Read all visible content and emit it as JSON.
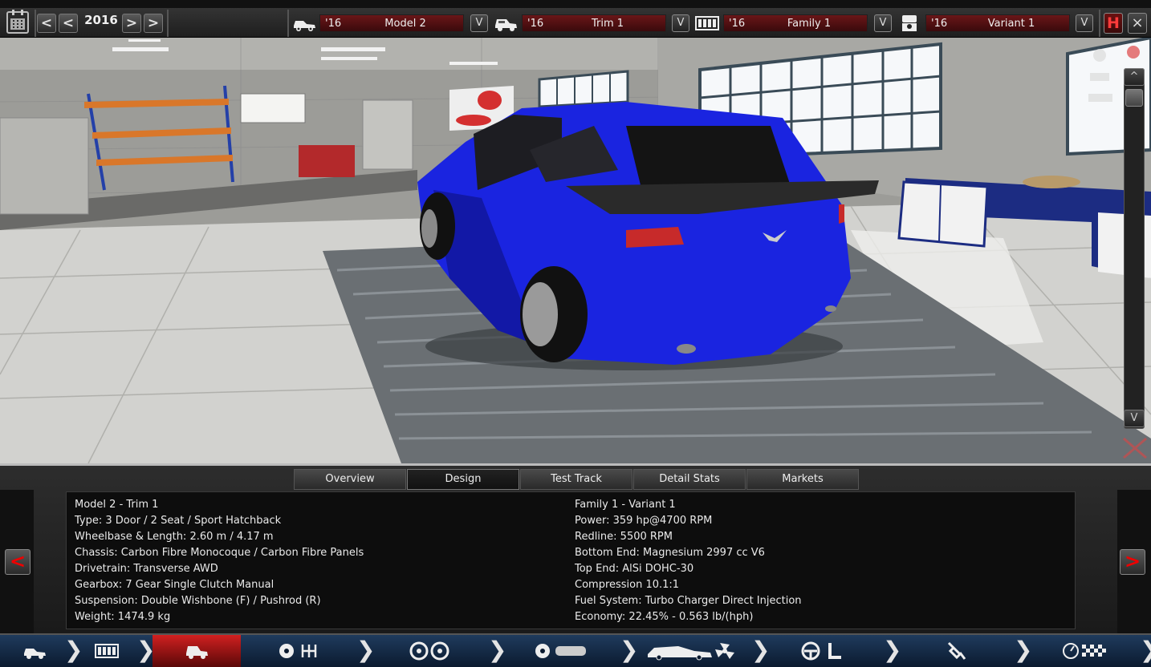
{
  "topbar": {
    "year": "2016",
    "prev_label": "<",
    "next_label": ">",
    "selectors": [
      {
        "year": "'16",
        "name": "Model 2",
        "icon": "car-model-icon"
      },
      {
        "year": "'16",
        "name": "Trim 1",
        "icon": "car-trim-icon"
      },
      {
        "year": "'16",
        "name": "Family 1",
        "icon": "engine-block-icon"
      },
      {
        "year": "'16",
        "name": "Variant 1",
        "icon": "piston-icon"
      }
    ],
    "dropdown_label": "V",
    "save_label": "H",
    "close_label": "×"
  },
  "viewport": {
    "scroll_up_label": "^",
    "scroll_down_label": "V",
    "car_color": "#1a24e0"
  },
  "tabs": [
    "Overview",
    "Design",
    "Test Track",
    "Detail Stats",
    "Markets"
  ],
  "active_tab": "Design",
  "panel": {
    "prev_label": "<",
    "next_label": ">"
  },
  "stats": {
    "left": [
      "Model 2 - Trim 1",
      "Type: 3 Door / 2 Seat / Sport Hatchback",
      "Wheelbase & Length: 2.60 m / 4.17 m",
      "Chassis: Carbon Fibre Monocoque / Carbon Fibre Panels",
      "Drivetrain: Transverse AWD",
      "Gearbox: 7 Gear Single Clutch Manual",
      "Suspension: Double Wishbone (F) / Pushrod (R)",
      "Weight: 1474.9 kg"
    ],
    "right": [
      "Family 1 - Variant 1",
      "Power: 359 hp@4700 RPM",
      "Redline: 5500 RPM",
      "Bottom End: Magnesium 2997 cc V6",
      "Top End: AlSi DOHC-30",
      "Compression 10.1:1",
      "Fuel System: Turbo Charger Direct Injection",
      "Economy: 22.45% - 0.563 lb/(hph)"
    ]
  },
  "bottombar": {
    "steps": [
      "car-model-step-icon",
      "engine-family-step-icon",
      "car-trim-step-icon",
      "gearbox-step-icon",
      "wheels-step-icon",
      "chassis-step-icon",
      "body-fan-step-icon",
      "interior-step-icon",
      "suspension-step-icon",
      "test-flag-step-icon"
    ],
    "active_step": "car-trim-step-icon"
  },
  "colors": {
    "accent_red": "#d02020",
    "selector_bg": "#6a1618",
    "bottom_bar": "#1f3b5d"
  }
}
